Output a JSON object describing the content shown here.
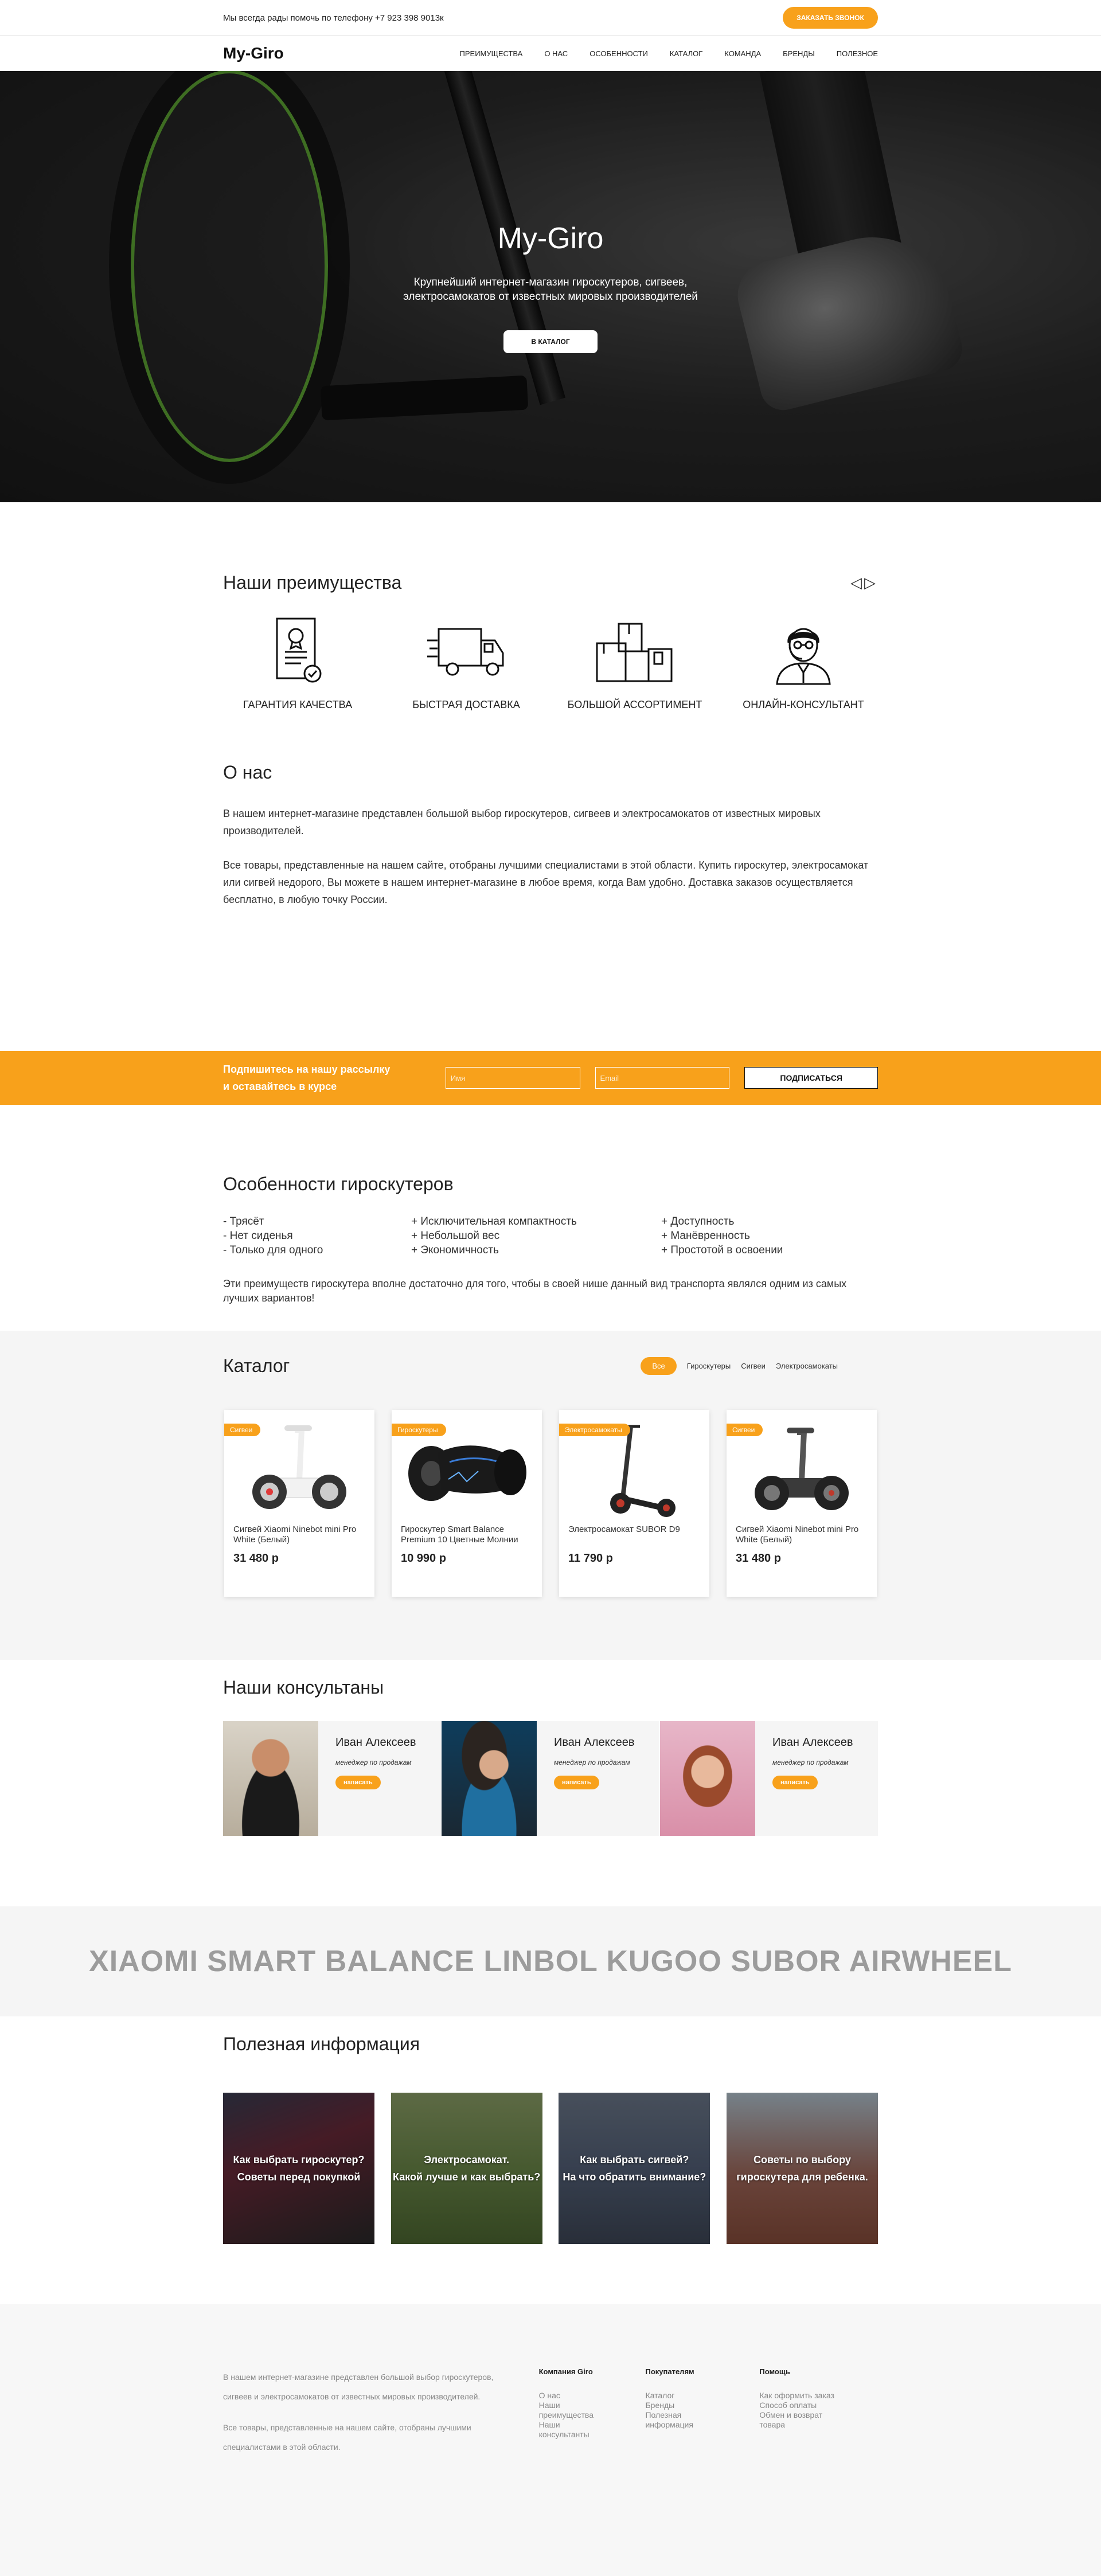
{
  "topbar": {
    "phone_text": "Мы всегда рады помочь по телефону +7 923 398 9013к",
    "callback_button": "Заказать звонок"
  },
  "navbar": {
    "logo": "My-Giro",
    "menu": [
      {
        "label": "Преимущества"
      },
      {
        "label": "О нас"
      },
      {
        "label": "Особенности"
      },
      {
        "label": "Каталог"
      },
      {
        "label": "Команда"
      },
      {
        "label": "Бренды"
      },
      {
        "label": "Полезное"
      }
    ]
  },
  "hero": {
    "title": "My-Giro",
    "subtitle": "Крупнейший интернет-магазин гироскутеров, сигвеев, электросамокатов от известных мировых производителей",
    "button": "В каталог"
  },
  "advantages": {
    "title": "Наши преимущества",
    "arrow_prev": "◁",
    "arrow_next": "▷",
    "items": [
      {
        "label": "Гарантия качества",
        "icon": "certificate-icon"
      },
      {
        "label": "Быстрая доставка",
        "icon": "truck-icon"
      },
      {
        "label": "Большой ассортимент",
        "icon": "boxes-icon"
      },
      {
        "label": "Онлайн-консультант",
        "icon": "consultant-icon"
      }
    ]
  },
  "about": {
    "title": "О нас",
    "p1": "В нашем интернет-магазине представлен большой выбор гироскутеров, сигвеев и электросамокатов от известных мировых производителей.",
    "p2": "Все товары, представленные на нашем сайте, отобраны лучшими специалистами в этой области. Купить гироскутер, электросамокат или сигвей недорого, Вы можете в нашем интернет-магазине в любое время, когда Вам удобно. Доставка заказов осуществляется бесплатно, в любую точку России."
  },
  "subscribe": {
    "line1": "Подпишитесь на нашу рассылку",
    "line2": "и оставайтесь в курсе",
    "name_placeholder": "Имя",
    "email_placeholder": "Email",
    "button": "Подписаться"
  },
  "features": {
    "title": "Особенности гироскутеров",
    "col1": [
      "- Трясёт",
      "- Нет сиденья",
      "- Только для одного"
    ],
    "col2": [
      "+ Исключительная компактность",
      "+ Небольшой вес",
      "+ Экономичность"
    ],
    "col3": [
      "+ Доступность",
      "+ Манёвренность",
      "+ Простотой в освоении"
    ],
    "note": "Эти преимуществ гироскутера вполне достаточно для того, чтобы в своей нише данный вид транспорта являлся одним из самых лучших вариантов!"
  },
  "catalog": {
    "title": "Каталог",
    "filters": [
      "Все",
      "Гироскутеры",
      "Сигвеи",
      "Электросамокаты"
    ],
    "products": [
      {
        "badge": "Сигвеи",
        "name": "Сигвей Xiaomi Ninebot mini Pro White (Белый)",
        "price": "31 480 р",
        "kind": "segway-white"
      },
      {
        "badge": "Гироскутеры",
        "name": "Гироскутер Smart Balance Premium 10 Цветные Молнии",
        "price": "10 990 р",
        "kind": "hoverboard"
      },
      {
        "badge": "Электросамокаты",
        "name": "Электросамокат SUBOR D9",
        "price": "11 790 р",
        "kind": "scooter"
      },
      {
        "badge": "Сигвеи",
        "name": "Сигвей Xiaomi Ninebot mini Pro White (Белый)",
        "price": "31 480 р",
        "kind": "segway-dark"
      }
    ]
  },
  "consultants": {
    "title": "Наши консультаны",
    "items": [
      {
        "name": "Иван Алексеев",
        "role": "менеджер по продажам",
        "button": "написать"
      },
      {
        "name": "Иван Алексеев",
        "role": "менеджер по продажам",
        "button": "написать"
      },
      {
        "name": "Иван Алексеев",
        "role": "менеджер по продажам",
        "button": "написать"
      }
    ]
  },
  "brands": {
    "text": "XIAOMI SMART BALANCE LINBOL KUGOO SUBOR AIRWHEEL"
  },
  "info": {
    "title": "Полезная информация",
    "items": [
      {
        "l1": "Как выбрать гироскутер?",
        "l2": "Советы перед покупкой"
      },
      {
        "l1": "Электросамокат.",
        "l2": "Какой лучше и как выбрать?"
      },
      {
        "l1": "Как выбрать сигвей?",
        "l2": "На что обратить внимание?"
      },
      {
        "l1": "Советы по выбору",
        "l2": "гироскутера для ребенка."
      }
    ]
  },
  "footer": {
    "about1": "В нашем интернет-магазине представлен большой выбор гироскутеров, сигвеев и электросамокатов от известных мировых производителей.",
    "about2": "Все товары, представленные на нашем сайте, отобраны лучшими специалистами в этой области.",
    "columns": [
      {
        "title": "Компания Giro",
        "links": [
          "О нас",
          "Наши преимущества",
          "Наши консультанты"
        ]
      },
      {
        "title": "Покупателям",
        "links": [
          "Каталог",
          "Бренды",
          "Полезная информация"
        ]
      },
      {
        "title": "Помощь",
        "links": [
          "Как оформить заказ",
          "Способ оплаты",
          "Обмен и возврат товара"
        ]
      }
    ]
  },
  "colors": {
    "accent": "#f8a11b",
    "light_bg": "#f5f5f5"
  }
}
